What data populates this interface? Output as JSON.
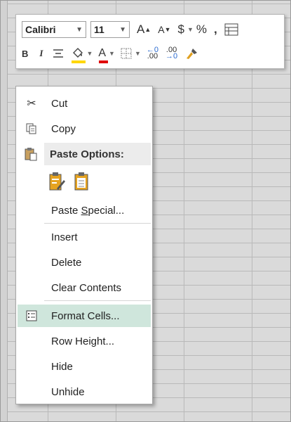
{
  "toolbar": {
    "font_name": "Calibri",
    "font_size": "11",
    "increase_font": "A",
    "decrease_font": "A",
    "currency": "$",
    "percent": "%",
    "comma": ",",
    "bold": "B",
    "italic": "I",
    "increase_decimal": ".00",
    "decrease_decimal": ".00",
    "fill_color": "#ffd700",
    "font_color": "#e00000"
  },
  "menu": {
    "cut": "Cut",
    "copy": "Copy",
    "paste_options": "Paste Options:",
    "paste_special": "Paste Special...",
    "insert": "Insert",
    "delete": "Delete",
    "clear_contents": "Clear Contents",
    "format_cells": "Format Cells...",
    "row_height": "Row Height...",
    "hide": "Hide",
    "unhide": "Unhide"
  },
  "highlight_color": "#cfe6dc"
}
